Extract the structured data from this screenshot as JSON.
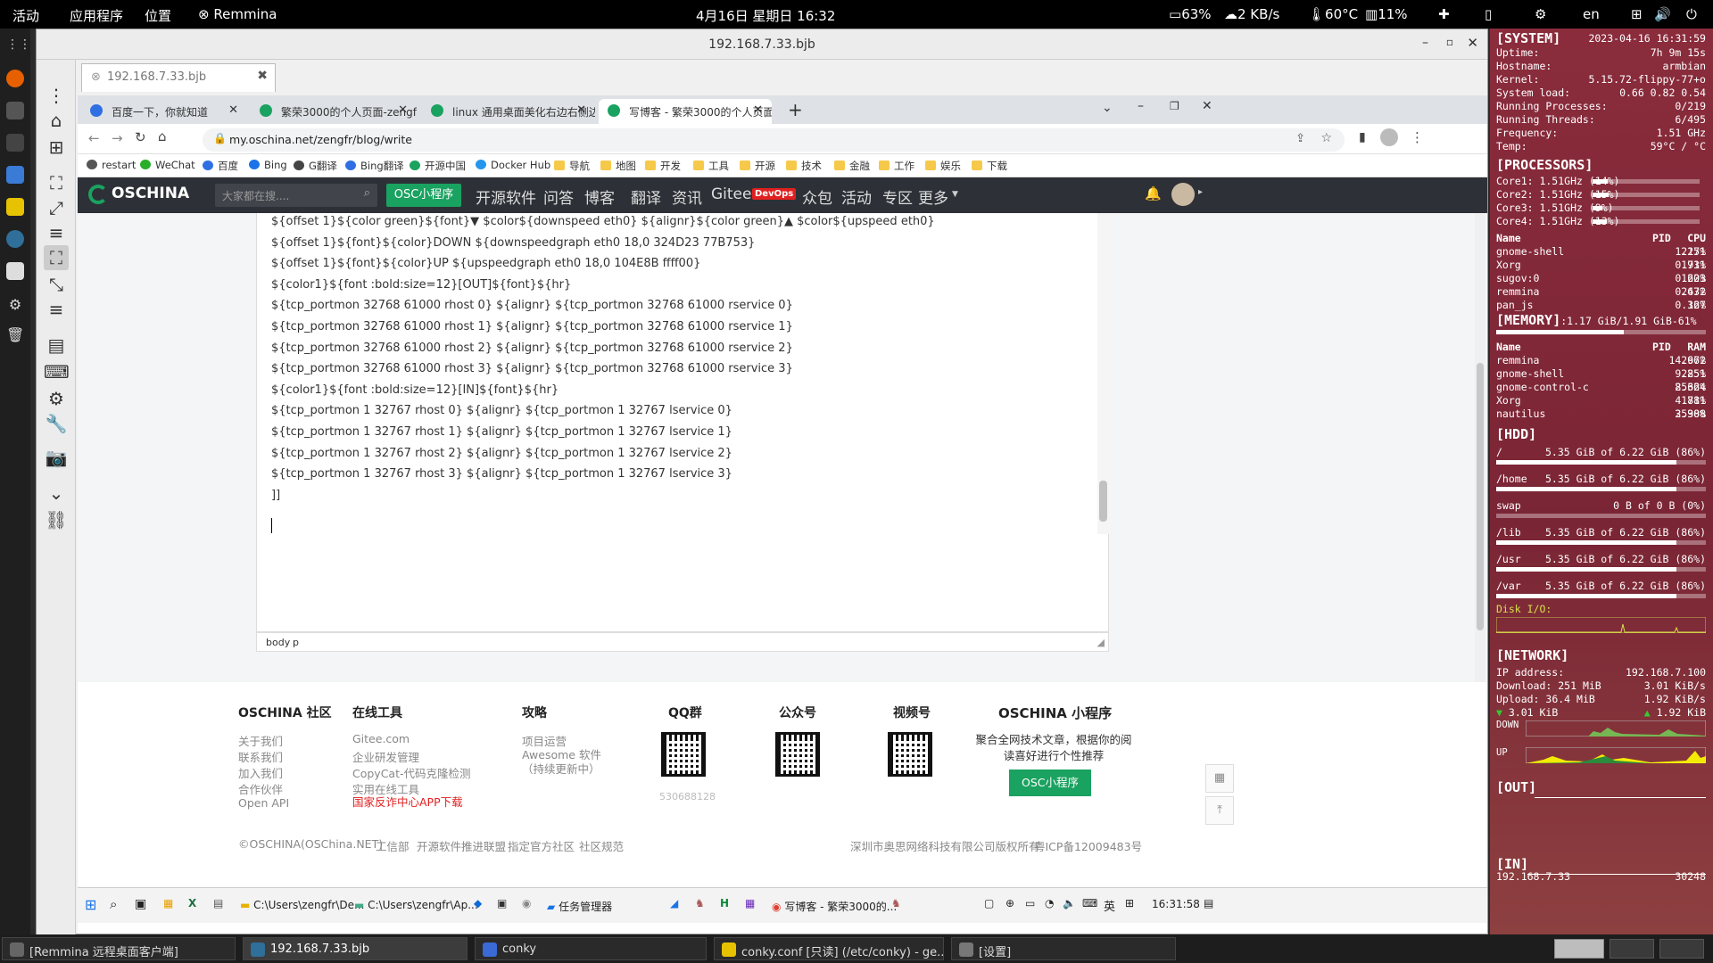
{
  "topbar": {
    "activities": "活动",
    "applications": "应用程序",
    "places": "位置",
    "app_name": "Remmina",
    "clock": "4月16日 星期日 16:32",
    "battery": "63%",
    "network_speed": "2 KB/s",
    "temperature": "60°C",
    "cpu_usage": "11%",
    "lang": "en"
  },
  "remmina": {
    "title": "192.168.7.33.bjb",
    "tab_label": "192.168.7.33.bjb"
  },
  "chrome": {
    "tabs": [
      {
        "label": "百度一下，你就知道",
        "color": "#2f6fe4"
      },
      {
        "label": "繁荣3000的个人页面-zengfr - OSC",
        "color": "#1aa260"
      },
      {
        "label": "linux 通用桌面美化右边右侧边栏",
        "color": "#1aa260"
      },
      {
        "label": "写博客 - 繁荣3000的个人页面-ze",
        "color": "#1aa260"
      }
    ],
    "new_tab": "+",
    "url": "my.oschina.net/zengfr/blog/write",
    "bookmarks": [
      {
        "label": "restart",
        "type": "site"
      },
      {
        "label": "WeChat",
        "type": "site"
      },
      {
        "label": "百度",
        "type": "site"
      },
      {
        "label": "Bing",
        "type": "site"
      },
      {
        "label": "G翻译",
        "type": "site"
      },
      {
        "label": "Bing翻译",
        "type": "site"
      },
      {
        "label": "开源中国",
        "type": "site"
      },
      {
        "label": "Docker Hub",
        "type": "site"
      },
      {
        "label": "导航",
        "type": "folder"
      },
      {
        "label": "地图",
        "type": "folder"
      },
      {
        "label": "开发",
        "type": "folder"
      },
      {
        "label": "工具",
        "type": "folder"
      },
      {
        "label": "开源",
        "type": "folder"
      },
      {
        "label": "技术",
        "type": "folder"
      },
      {
        "label": "金融",
        "type": "folder"
      },
      {
        "label": "工作",
        "type": "folder"
      },
      {
        "label": "娱乐",
        "type": "folder"
      },
      {
        "label": "下载",
        "type": "folder"
      }
    ]
  },
  "oschina": {
    "logo": "OSCHINA",
    "search_placeholder": "大家都在搜....",
    "mini_program_btn": "OSC小程序",
    "nav": [
      "开源软件",
      "问答",
      "博客",
      "翻译",
      "资讯",
      "Gitee",
      "众包",
      "活动",
      "专区",
      "更多"
    ],
    "devops_badge": "DevOps"
  },
  "editor": {
    "lines": [
      "${offset 1}${color green}${font}▼ $color${downspeed eth0} ${alignr}${color green}▲ $color${upspeed eth0}",
      "${offset 1}${font}${color}DOWN ${downspeedgraph eth0 18,0 324D23 77B753}",
      "${offset 1}${font}${color}UP   ${upspeedgraph eth0 18,0 104E8B ffff00}",
      "${color1}${font :bold:size=12}[OUT]${font}${hr}",
      "${tcp_portmon 32768 61000 rhost 0} ${alignr} ${tcp_portmon 32768 61000 rservice 0}",
      "${tcp_portmon 32768 61000 rhost 1} ${alignr} ${tcp_portmon 32768 61000 rservice 1}",
      "${tcp_portmon 32768 61000 rhost 2} ${alignr} ${tcp_portmon 32768 61000 rservice 2}",
      "${tcp_portmon 32768 61000 rhost 3} ${alignr} ${tcp_portmon 32768 61000 rservice 3}",
      "${color1}${font :bold:size=12}[IN]${font}${hr}",
      "${tcp_portmon 1 32767 rhost 0} ${alignr} ${tcp_portmon 1 32767 lservice 0}",
      "${tcp_portmon 1 32767 rhost 1} ${alignr} ${tcp_portmon 1 32767 lservice 1}",
      "${tcp_portmon 1 32767 rhost 2} ${alignr} ${tcp_portmon 1 32767 lservice 2}",
      "${tcp_portmon 1 32767 rhost 3} ${alignr} ${tcp_portmon 1 32767 lservice 3}",
      "]]"
    ],
    "status_body": "body",
    "status_p": "p"
  },
  "footer": {
    "community_title": "OSCHINA 社区",
    "community_links": [
      "关于我们",
      "联系我们",
      "加入我们",
      "合作伙伴",
      "Open API"
    ],
    "tools_title": "在线工具",
    "tools_links": [
      "Gitee.com",
      "企业研发管理",
      "CopyCat-代码克隆检测",
      "实用在线工具"
    ],
    "tools_red_link": "国家反诈中心APP下载",
    "guide_title": "攻略",
    "guide_links": [
      "项目运营",
      "Awesome 软件（持续更新中）"
    ],
    "qq_title": "QQ群",
    "qq_number": "530688128",
    "gzh_title": "公众号",
    "video_title": "视频号",
    "mini_title": "OSCHINA 小程序",
    "mini_desc": "聚合全网技术文章，根据你的阅读喜好进行个性推荐",
    "mini_btn": "OSC小程序",
    "bottom_links": [
      "©OSCHINA(OSChina.NET)",
      "工信部",
      "开源软件推进联盟",
      "指定官方社区",
      "社区规范"
    ],
    "company": "深圳市奥思网络科技有限公司版权所有",
    "icp": "粤ICP备12009483号"
  },
  "windows_taskbar": {
    "items": [
      "C:\\Users\\zengfr\\De...",
      "C:\\Users\\zengfr\\Ap...",
      "任务管理器",
      "写博客 - 繁荣3000的..."
    ],
    "ime": "英",
    "clock": "16:31:58"
  },
  "conky": {
    "system_header": "[SYSTEM]",
    "datetime": "2023-04-16 16:31:59",
    "system_rows": [
      {
        "label": "Uptime:",
        "value": "7h 9m 15s"
      },
      {
        "label": "Hostname:",
        "value": "armbian"
      },
      {
        "label": "Kernel:",
        "value": "5.15.72-flippy-77+o"
      },
      {
        "label": "System load:",
        "value": "0.66 0.82 0.54"
      },
      {
        "label": "Running Processes:",
        "value": "0/219"
      },
      {
        "label": "Running Threads:",
        "value": "6/495"
      },
      {
        "label": "Frequency:",
        "value": "1.51 GHz"
      },
      {
        "label": "Temp:",
        "value": "59°C / °C"
      }
    ],
    "processors_header": "[PROCESSORS]",
    "cores": [
      {
        "label": "Core1: 1.51GHz (14%)",
        "pct": 14
      },
      {
        "label": "Core2: 1.51GHz (15%)",
        "pct": 15
      },
      {
        "label": "Core3: 1.51GHz (9%)",
        "pct": 9
      },
      {
        "label": "Core4: 1.51GHz (13%)",
        "pct": 13
      }
    ],
    "cpu_table_headers": [
      "Name",
      "PID",
      "CPU"
    ],
    "cpu_procs": [
      [
        "gnome-shell",
        "2251",
        "1.17%"
      ],
      [
        "Xorg",
        "1711",
        "0.93%"
      ],
      [
        "sugov:0",
        "1223",
        "0.60%"
      ],
      [
        "remmina",
        "2672",
        "0.43%"
      ],
      [
        "pan_js",
        "367",
        "0.12%"
      ]
    ],
    "memory_header": "[MEMORY]",
    "memory_value": ":1.17 GiB/1.91 GiB-61%",
    "memory_pct": 61,
    "mem_table_headers": [
      "Name",
      "PID",
      "RAM"
    ],
    "mem_procs": [
      [
        "remmina",
        "2672",
        "14.96%"
      ],
      [
        "gnome-shell",
        "2251",
        "9.85%"
      ],
      [
        "gnome-control-c",
        "25664",
        "8.32%"
      ],
      [
        "Xorg",
        "1711",
        "4.88%"
      ],
      [
        "nautilus",
        "25388",
        "3.90%"
      ]
    ],
    "hdd_header": "[HDD]",
    "disks": [
      {
        "label": "/",
        "value": "5.35 GiB of 6.22 GiB (86%)",
        "pct": 86
      },
      {
        "label": "/home",
        "value": "5.35 GiB of 6.22 GiB (86%)",
        "pct": 86
      },
      {
        "label": "swap",
        "value": "0 B of 0 B (0%)",
        "pct": 0
      },
      {
        "label": "/lib",
        "value": "5.35 GiB of 6.22 GiB (86%)",
        "pct": 86
      },
      {
        "label": "/usr",
        "value": "5.35 GiB of 6.22 GiB (86%)",
        "pct": 86
      },
      {
        "label": "/var",
        "value": "5.35 GiB of 6.22 GiB (86%)",
        "pct": 86
      }
    ],
    "disk_io_label": "Disk I/O:",
    "network_header": "[NETWORK]",
    "ip_label": "IP address:",
    "ip_value": "192.168.7.100",
    "download_label": "Download:",
    "download_total": "251 MiB",
    "download_rate": "3.01 KiB/s",
    "upload_label": "Upload:",
    "upload_total": "36.4 MiB",
    "upload_rate": "1.92 KiB/s",
    "down_speed": "3.01 KiB",
    "up_speed": "1.92 KiB",
    "down_graph_label": "DOWN",
    "up_graph_label": "UP",
    "out_header": "[OUT]",
    "in_header": "[IN]",
    "in_host": "192.168.7.33",
    "in_port": "30248"
  },
  "bottombar": {
    "items": [
      {
        "label": "[Remmina 远程桌面客户端]",
        "active": false
      },
      {
        "label": "192.168.7.33.bjb",
        "active": true
      },
      {
        "label": "conky",
        "active": false
      },
      {
        "label": "conky.conf [只读] (/etc/conky) - ge...",
        "active": false
      },
      {
        "label": "[设置]",
        "active": false
      }
    ]
  }
}
